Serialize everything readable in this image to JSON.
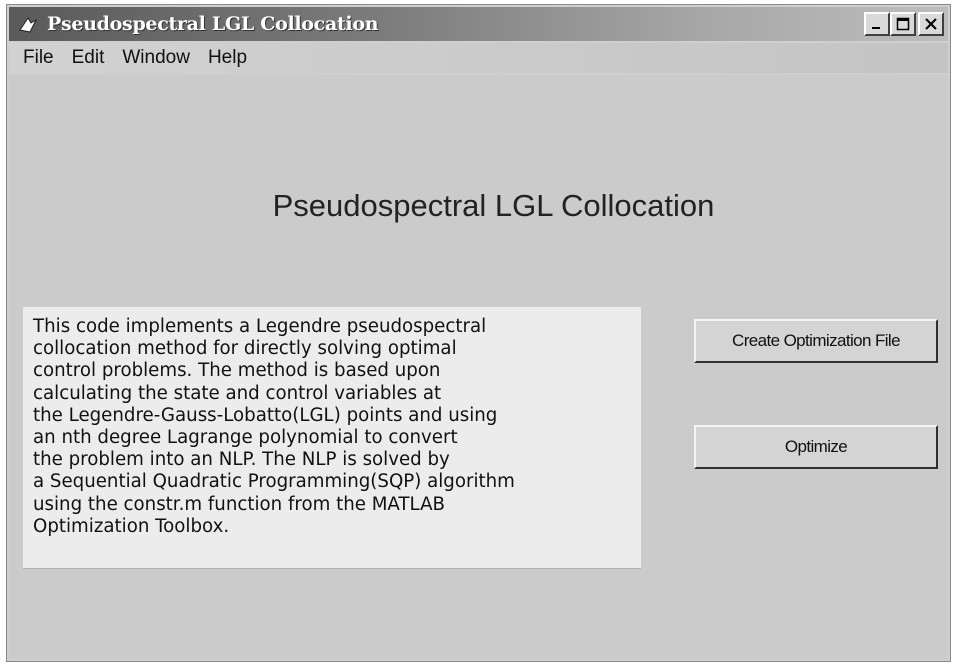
{
  "window": {
    "title": "Pseudospectral LGL Collocation",
    "controls": {
      "minimize": "_",
      "maximize": "□",
      "close": "×"
    }
  },
  "menu": {
    "items": [
      {
        "label": "File"
      },
      {
        "label": "Edit"
      },
      {
        "label": "Window"
      },
      {
        "label": "Help"
      }
    ]
  },
  "main": {
    "heading": "Pseudospectral LGL Collocation",
    "description_lines": [
      "This code implements a Legendre pseudospectral",
      "collocation method for directly solving optimal",
      "control problems.  The method is based upon",
      "calculating the state and control variables at",
      "the Legendre-Gauss-Lobatto(LGL) points and using",
      "an nth degree Lagrange polynomial to convert",
      "the problem into an NLP.  The NLP is solved by",
      "a Sequential Quadratic Programming(SQP) algorithm",
      "using the constr.m function from the MATLAB",
      "Optimization Toolbox."
    ]
  },
  "buttons": {
    "create_label": "Create Optimization File",
    "optimize_label": "Optimize"
  },
  "icons": {
    "app": "matlab-figure-icon"
  },
  "colors": {
    "window_bg": "#cbcbcb",
    "title_gradient_start": "#5a5a5a",
    "title_gradient_end": "#bdbdbd",
    "text_box_bg": "#ececec"
  }
}
